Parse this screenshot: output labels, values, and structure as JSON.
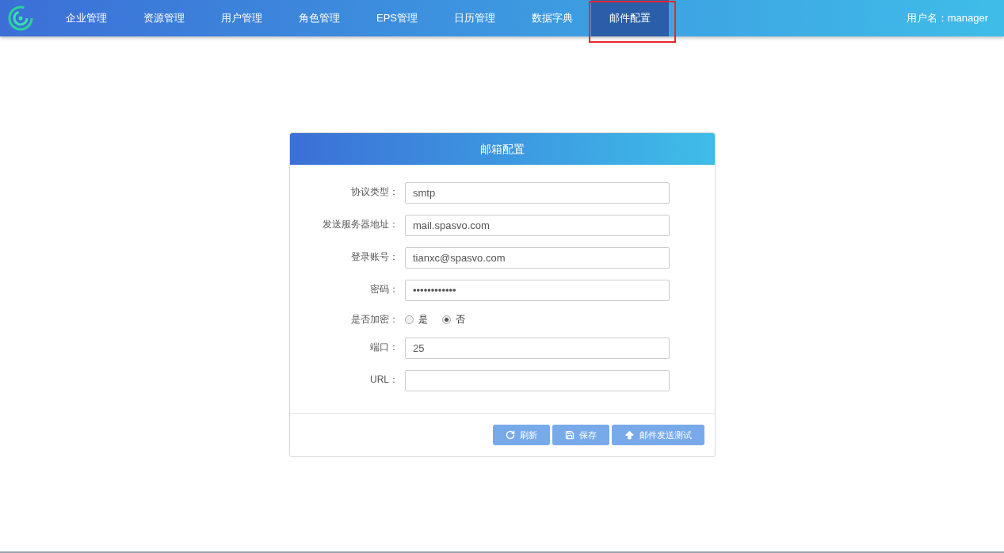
{
  "nav": {
    "items": [
      {
        "label": "企业管理",
        "selected": false
      },
      {
        "label": "资源管理",
        "selected": false
      },
      {
        "label": "用户管理",
        "selected": false
      },
      {
        "label": "角色管理",
        "selected": false
      },
      {
        "label": "EPS管理",
        "selected": false
      },
      {
        "label": "日历管理",
        "selected": false
      },
      {
        "label": "数据字典",
        "selected": false
      },
      {
        "label": "邮件配置",
        "selected": true
      }
    ],
    "user": "用户名：manager"
  },
  "card": {
    "title": "邮箱配置",
    "fields": [
      {
        "kind": "text",
        "label": "协议类型：",
        "value": "smtp"
      },
      {
        "kind": "text",
        "label": "发送服务器地址：",
        "value": "mail.spasvo.com"
      },
      {
        "kind": "text",
        "label": "登录账号：",
        "value": "tianxc@spasvo.com"
      },
      {
        "kind": "password",
        "label": "密码：",
        "value": "••••••••••••"
      },
      {
        "kind": "radio",
        "label": "是否加密：",
        "options": [
          {
            "label": "是",
            "selected": false
          },
          {
            "label": "否",
            "selected": true
          }
        ]
      },
      {
        "kind": "text",
        "label": "端口：",
        "value": "25"
      },
      {
        "kind": "text",
        "label": "URL："
      }
    ],
    "buttons": [
      {
        "kind": "refresh",
        "label": "刷新"
      },
      {
        "kind": "save",
        "label": "保存"
      },
      {
        "kind": "upload",
        "label": "邮件发送测试"
      }
    ]
  }
}
